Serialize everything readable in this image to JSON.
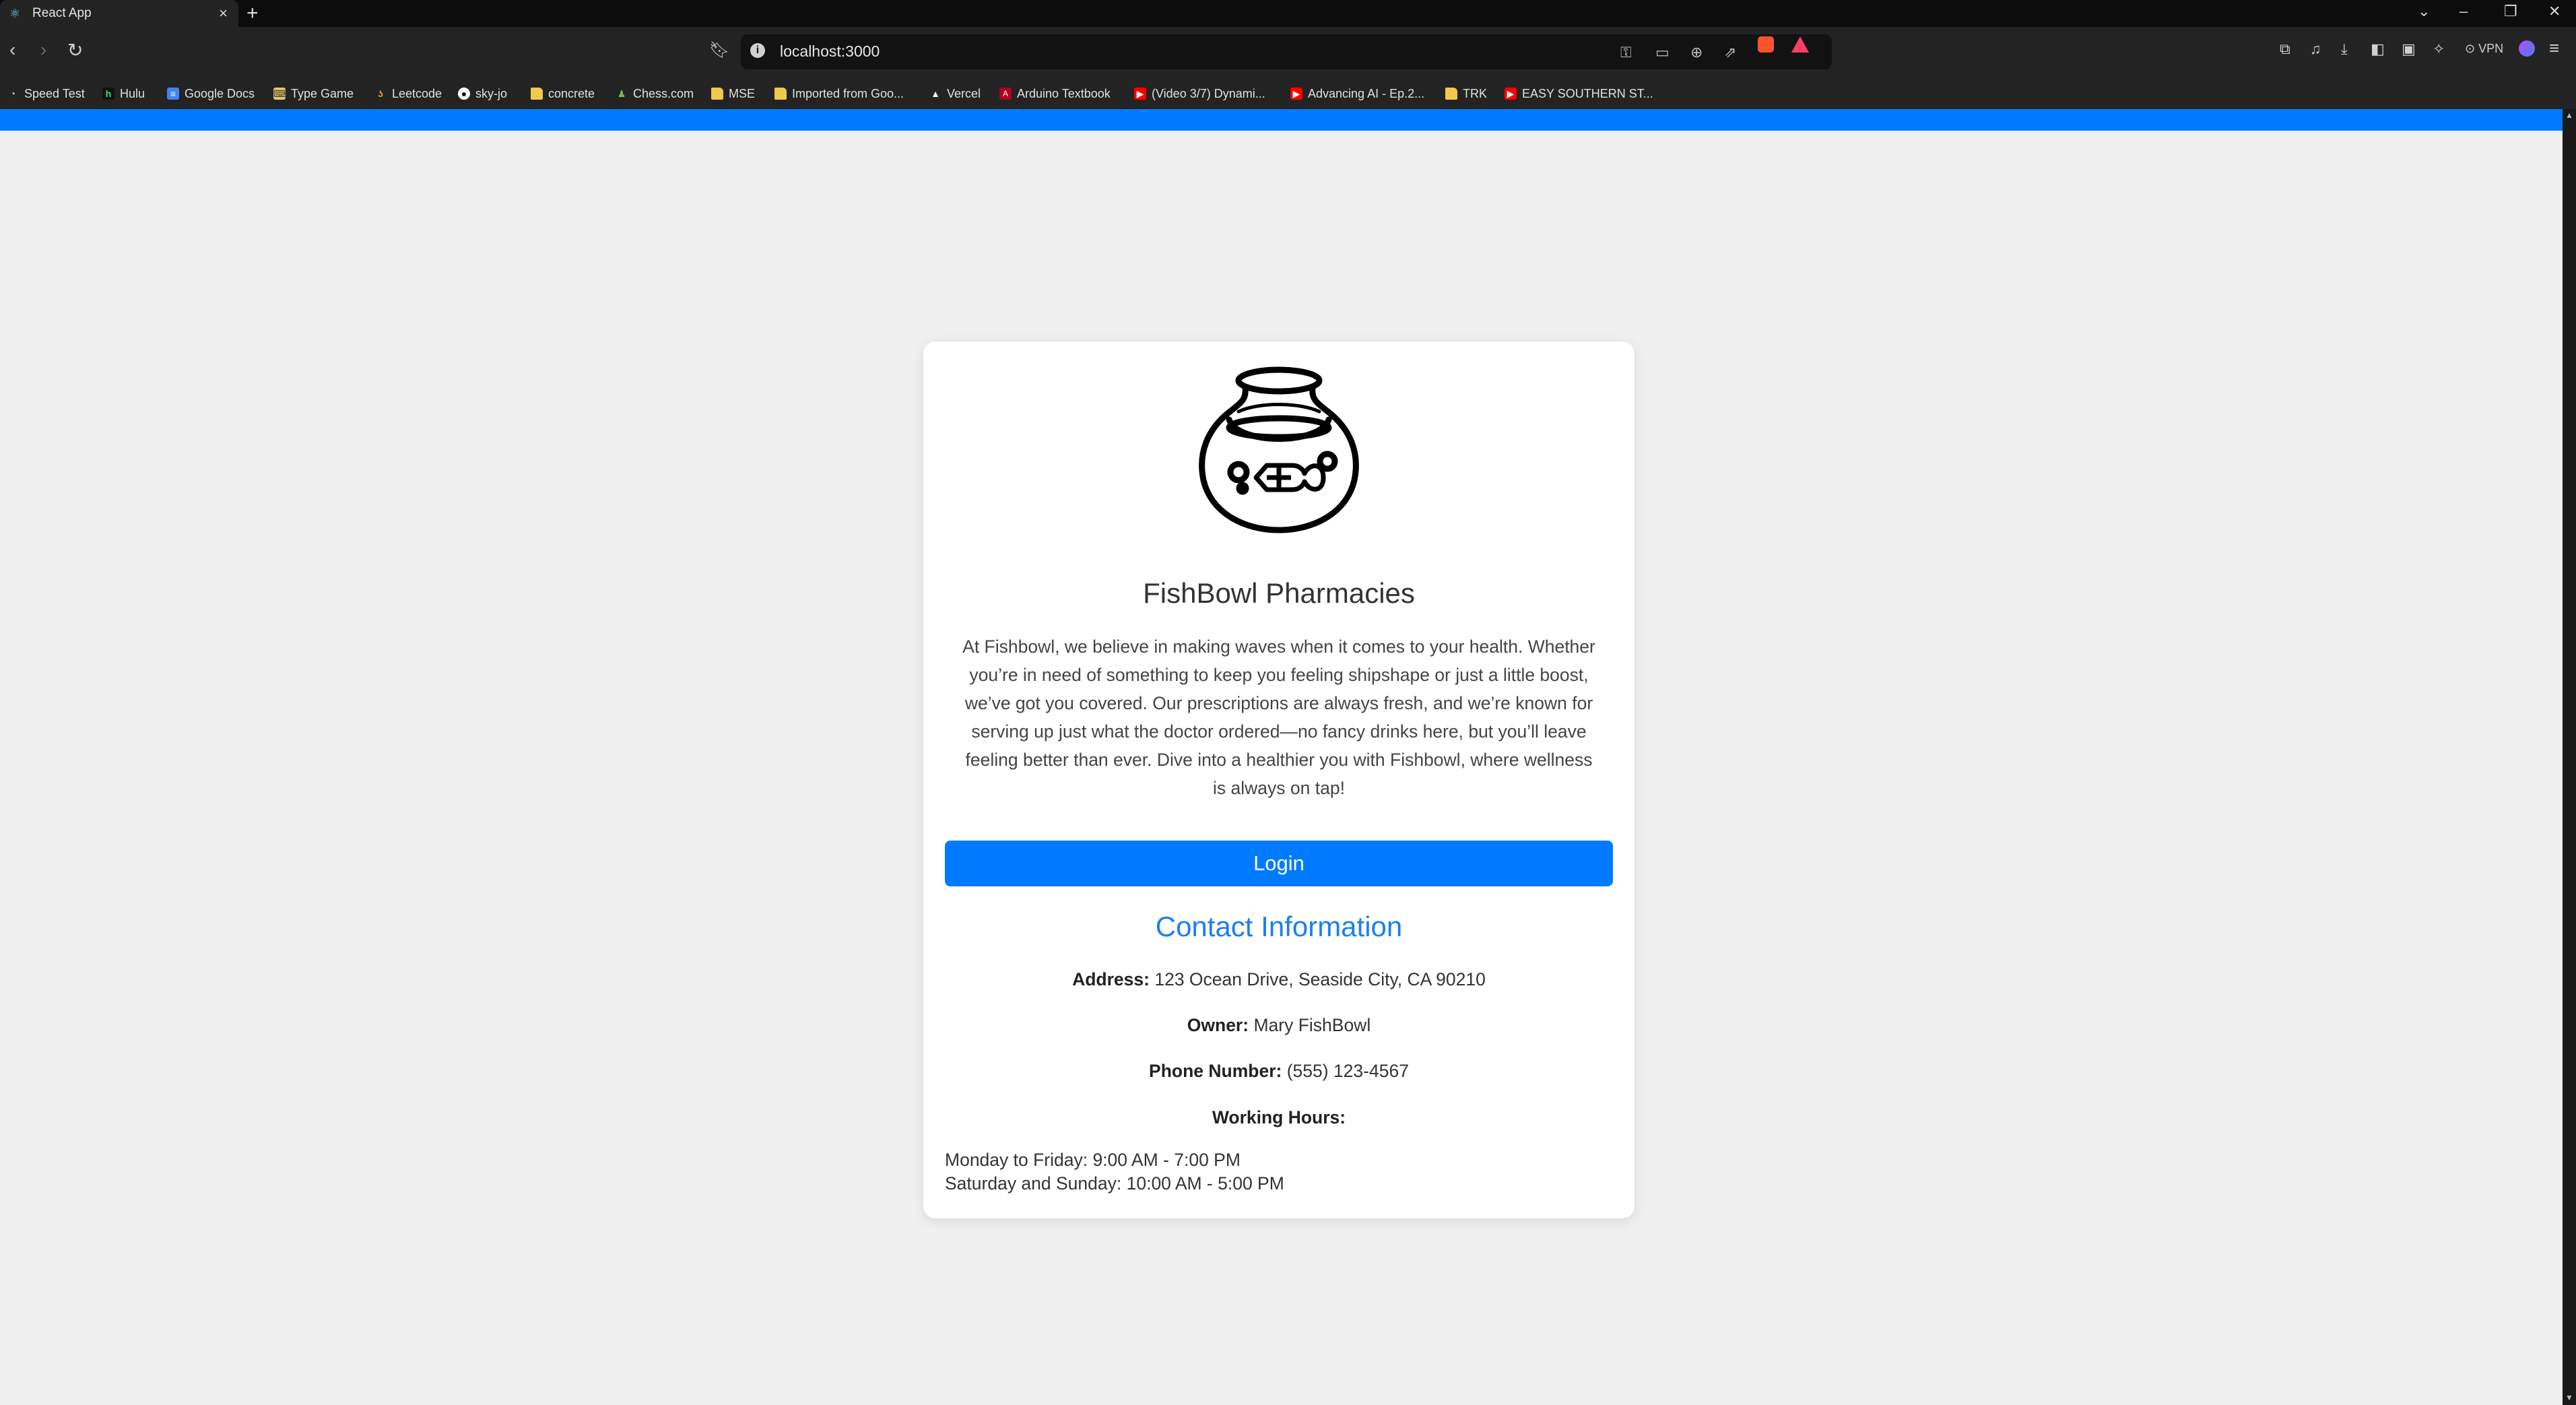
{
  "browser": {
    "tab_title": "React App",
    "url": "localhost:3000",
    "vpn_label": "VPN",
    "bookmarks": [
      "Speed Test",
      "Hulu",
      "Google Docs",
      "Type Game",
      "Leetcode",
      "sky-jo",
      "concrete",
      "Chess.com",
      "MSE",
      "Imported from Goo...",
      "Vercel",
      "Arduino Textbook",
      "(Video 3/7) Dynami...",
      "Advancing AI - Ep.2...",
      "TRK",
      "EASY SOUTHERN ST..."
    ]
  },
  "page": {
    "brand_name": "FishBowl Pharmacies",
    "description": "At Fishbowl, we believe in making waves when it comes to your health. Whether you’re in need of something to keep you feeling shipshape or just a little boost, we’ve got you covered. Our prescriptions are always fresh, and we’re known for serving up just what the doctor ordered—no fancy drinks here, but you’ll leave feeling better than ever. Dive into a healthier you with Fishbowl, where wellness is always on tap!",
    "login_label": "Login",
    "contact_title": "Contact Information",
    "address_label": "Address:",
    "address_value": "123 Ocean Drive, Seaside City, CA 90210",
    "owner_label": "Owner:",
    "owner_value": "Mary FishBowl",
    "phone_label": "Phone Number:",
    "phone_value": "(555) 123-4567",
    "hours_label": "Working Hours:",
    "hours_weekday": "Monday to Friday: 9:00 AM - 7:00 PM",
    "hours_weekend": "Saturday and Sunday: 10:00 AM - 5:00 PM"
  },
  "colors": {
    "accent": "#007bff",
    "contact_title": "#1a7ff0",
    "page_background": "#f0f0f0"
  }
}
